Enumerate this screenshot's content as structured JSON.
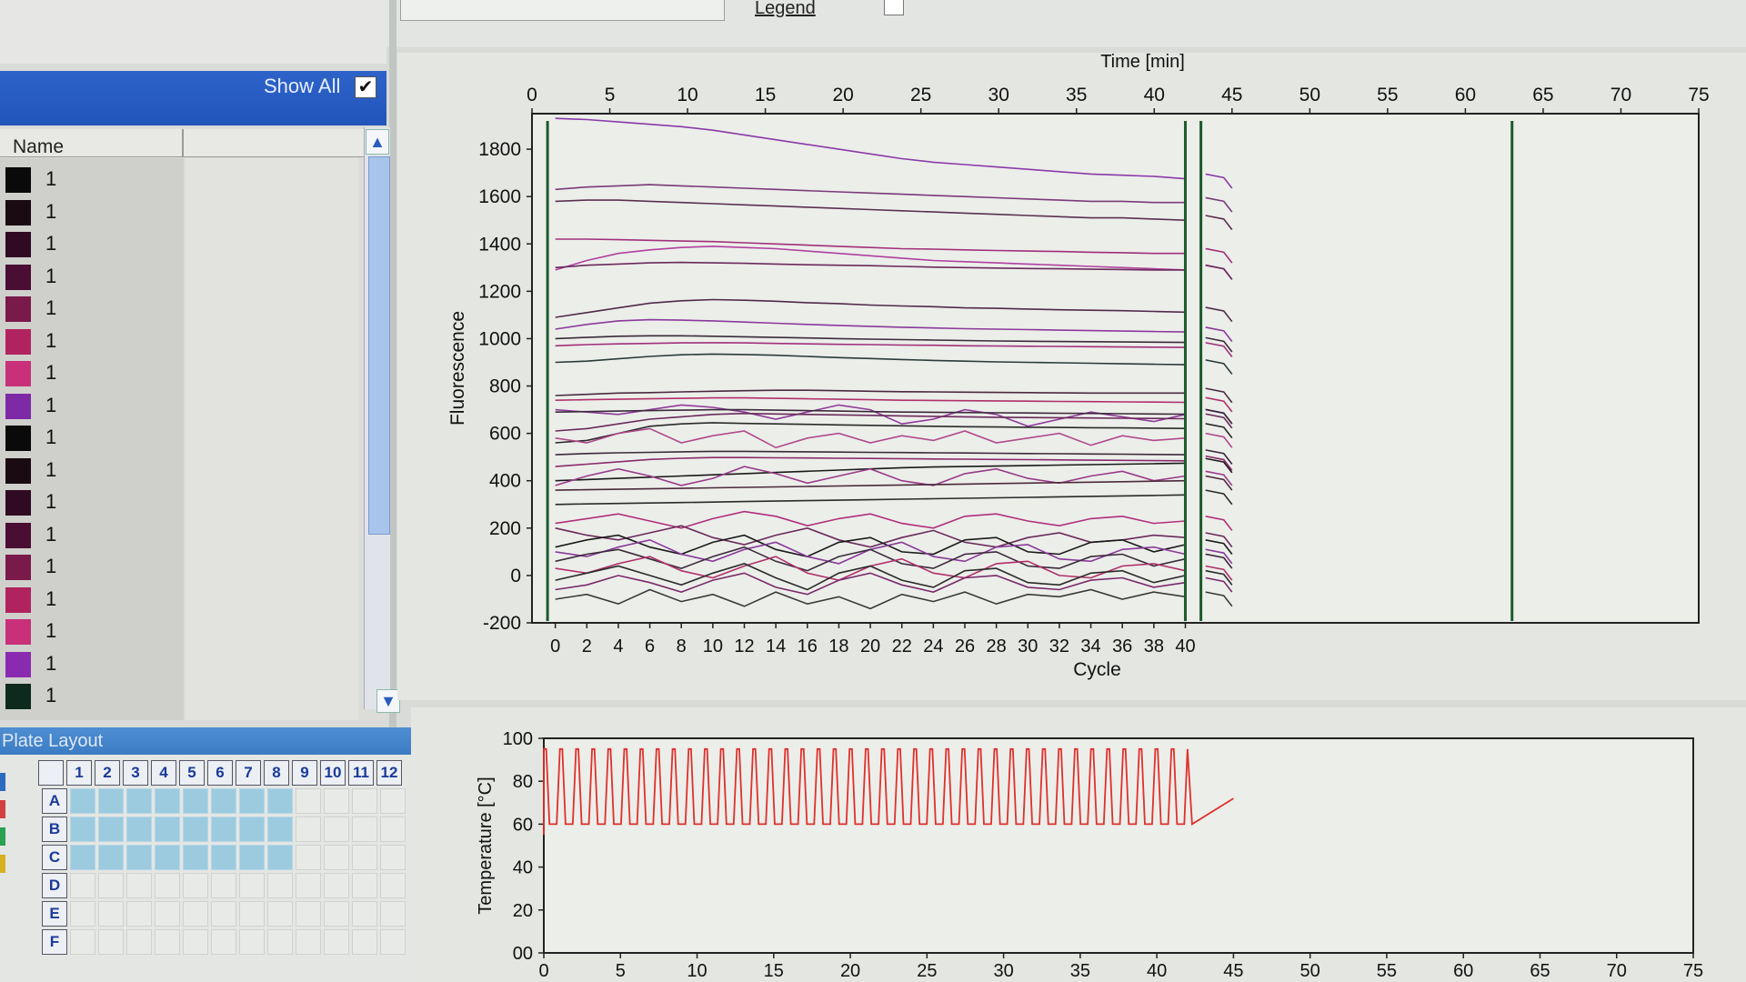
{
  "top_toolbar": {
    "legend_label": "Legend"
  },
  "sample_list": {
    "show_all_label": "Show All",
    "show_all_checked": true,
    "column_name": "Name",
    "rows": [
      {
        "label": "1",
        "color": "#0a0a0a"
      },
      {
        "label": "1",
        "color": "#1a0a12"
      },
      {
        "label": "1",
        "color": "#300a22"
      },
      {
        "label": "1",
        "color": "#4a0d34"
      },
      {
        "label": "1",
        "color": "#7a1a4a"
      },
      {
        "label": "1",
        "color": "#b0235e"
      },
      {
        "label": "1",
        "color": "#c8307a"
      },
      {
        "label": "1",
        "color": "#7e2aa6"
      },
      {
        "label": "1",
        "color": "#0a0a0a"
      },
      {
        "label": "1",
        "color": "#1a0a12"
      },
      {
        "label": "1",
        "color": "#300a22"
      },
      {
        "label": "1",
        "color": "#4a0d34"
      },
      {
        "label": "1",
        "color": "#7a1a4a"
      },
      {
        "label": "1",
        "color": "#b0235e"
      },
      {
        "label": "1",
        "color": "#c8307a"
      },
      {
        "label": "1",
        "color": "#8a2ab0"
      },
      {
        "label": "1",
        "color": "#0e2a1e"
      }
    ]
  },
  "plate_layout": {
    "title": "Plate Layout",
    "columns": [
      "1",
      "2",
      "3",
      "4",
      "5",
      "6",
      "7",
      "8",
      "9",
      "10",
      "11",
      "12"
    ],
    "rows": [
      "A",
      "B",
      "C",
      "D",
      "E",
      "F"
    ],
    "filled_rows": 3,
    "filled_columns": 8,
    "side_colors": [
      "#2a6cc0",
      "#d24040",
      "#2aa050",
      "#d8b020"
    ]
  },
  "chart_data": [
    {
      "type": "line",
      "x_top_label": "Time [min]",
      "x_top_ticks": [
        "0",
        "5",
        "10",
        "15",
        "20",
        "25",
        "30",
        "35",
        "40",
        "45",
        "50",
        "55",
        "60",
        "65",
        "70",
        "75"
      ],
      "xlabel": "Cycle",
      "x_bottom_ticks": [
        "0",
        "2",
        "4",
        "6",
        "8",
        "10",
        "12",
        "14",
        "16",
        "18",
        "20",
        "22",
        "24",
        "26",
        "28",
        "30",
        "32",
        "34",
        "36",
        "38",
        "40"
      ],
      "ylabel": "Fluorescence",
      "y_ticks": [
        "1800",
        "1600",
        "1400",
        "1200",
        "1000",
        "800",
        "600",
        "400",
        "200",
        "0",
        "-200"
      ],
      "ylim": [
        -200,
        1950
      ],
      "time_range": [
        0,
        75
      ],
      "marker_lines_minutes": [
        1,
        42,
        43,
        63
      ],
      "cycles": 40,
      "series": [
        {
          "color": "#8a3aa8",
          "values": [
            1930,
            1925,
            1915,
            1905,
            1895,
            1880,
            1860,
            1840,
            1820,
            1800,
            1780,
            1760,
            1745,
            1735,
            1725,
            1715,
            1705,
            1695,
            1690,
            1685,
            1675
          ]
        },
        {
          "color": "#7a3a7a",
          "values": [
            1630,
            1640,
            1645,
            1650,
            1645,
            1640,
            1635,
            1630,
            1625,
            1620,
            1615,
            1610,
            1605,
            1600,
            1595,
            1590,
            1585,
            1580,
            1580,
            1575,
            1575
          ]
        },
        {
          "color": "#5a3050",
          "values": [
            1580,
            1585,
            1585,
            1580,
            1575,
            1570,
            1565,
            1560,
            1555,
            1550,
            1545,
            1540,
            1535,
            1530,
            1525,
            1520,
            1515,
            1510,
            1510,
            1505,
            1500
          ]
        },
        {
          "color": "#a0307a",
          "values": [
            1420,
            1420,
            1418,
            1415,
            1412,
            1410,
            1405,
            1400,
            1395,
            1390,
            1385,
            1380,
            1378,
            1375,
            1372,
            1370,
            1368,
            1365,
            1363,
            1360,
            1360
          ]
        },
        {
          "color": "#b040a0",
          "values": [
            1290,
            1330,
            1360,
            1375,
            1385,
            1390,
            1385,
            1380,
            1370,
            1360,
            1350,
            1340,
            1330,
            1325,
            1320,
            1315,
            1310,
            1305,
            1300,
            1295,
            1290
          ]
        },
        {
          "color": "#6a2a5a",
          "values": [
            1300,
            1310,
            1315,
            1320,
            1322,
            1320,
            1318,
            1315,
            1312,
            1310,
            1308,
            1305,
            1302,
            1300,
            1298,
            1296,
            1295,
            1293,
            1292,
            1290,
            1290
          ]
        },
        {
          "color": "#502a4a",
          "values": [
            1090,
            1110,
            1130,
            1150,
            1160,
            1165,
            1162,
            1158,
            1152,
            1148,
            1142,
            1138,
            1135,
            1130,
            1128,
            1125,
            1122,
            1120,
            1118,
            1115,
            1112
          ]
        },
        {
          "color": "#8a3a9a",
          "values": [
            1040,
            1060,
            1075,
            1080,
            1078,
            1075,
            1070,
            1065,
            1060,
            1056,
            1052,
            1048,
            1045,
            1042,
            1040,
            1038,
            1036,
            1034,
            1032,
            1030,
            1028
          ]
        },
        {
          "color": "#3a2a3a",
          "values": [
            1000,
            1005,
            1010,
            1012,
            1012,
            1010,
            1008,
            1005,
            1003,
            1000,
            998,
            996,
            994,
            992,
            990,
            989,
            988,
            987,
            986,
            985,
            984
          ]
        },
        {
          "color": "#a0307a",
          "values": [
            970,
            975,
            978,
            980,
            982,
            983,
            982,
            980,
            978,
            976,
            975,
            973,
            972,
            970,
            969,
            968,
            967,
            966,
            965,
            964,
            963
          ]
        },
        {
          "color": "#2a3a3a",
          "values": [
            900,
            905,
            915,
            925,
            932,
            935,
            933,
            930,
            925,
            920,
            916,
            912,
            908,
            905,
            902,
            900,
            898,
            896,
            894,
            892,
            890
          ]
        },
        {
          "color": "#4a2a40",
          "values": [
            760,
            765,
            770,
            772,
            775,
            778,
            780,
            782,
            782,
            780,
            778,
            776,
            775,
            774,
            773,
            772,
            771,
            770,
            770,
            770,
            770
          ]
        },
        {
          "color": "#b0306a",
          "values": [
            740,
            742,
            744,
            746,
            748,
            750,
            750,
            748,
            746,
            744,
            742,
            740,
            739,
            738,
            737,
            736,
            735,
            734,
            733,
            732,
            731
          ]
        },
        {
          "color": "#903a9a",
          "values": [
            700,
            690,
            680,
            700,
            720,
            710,
            690,
            660,
            690,
            720,
            700,
            640,
            660,
            700,
            680,
            630,
            660,
            690,
            670,
            650,
            680
          ]
        },
        {
          "color": "#3a2a3a",
          "values": [
            690,
            692,
            694,
            696,
            698,
            700,
            700,
            698,
            696,
            694,
            692,
            690,
            689,
            688,
            687,
            686,
            685,
            684,
            683,
            682,
            681
          ]
        },
        {
          "color": "#6a2a5a",
          "values": [
            610,
            620,
            640,
            660,
            670,
            680,
            684,
            682,
            680,
            678,
            676,
            674,
            672,
            670,
            668,
            667,
            666,
            665,
            664,
            663,
            662
          ]
        },
        {
          "color": "#2a2a2a",
          "values": [
            560,
            570,
            600,
            630,
            640,
            645,
            642,
            640,
            638,
            636,
            634,
            632,
            630,
            628,
            627,
            626,
            625,
            624,
            623,
            622,
            621
          ]
        },
        {
          "color": "#b04a8a",
          "values": [
            580,
            560,
            600,
            620,
            560,
            590,
            610,
            540,
            580,
            600,
            560,
            590,
            570,
            610,
            560,
            580,
            600,
            550,
            590,
            570,
            580
          ]
        },
        {
          "color": "#3a2a3a",
          "values": [
            510,
            515,
            518,
            520,
            522,
            524,
            524,
            523,
            522,
            521,
            520,
            519,
            518,
            517,
            516,
            515,
            514,
            513,
            512,
            511,
            510
          ]
        },
        {
          "color": "#8a2a6a",
          "values": [
            460,
            470,
            480,
            490,
            495,
            498,
            498,
            497,
            496,
            495,
            494,
            493,
            492,
            491,
            490,
            489,
            488,
            487,
            486,
            485,
            484
          ]
        },
        {
          "color": "#1a1a1a",
          "values": [
            400,
            405,
            410,
            415,
            420,
            425,
            430,
            435,
            440,
            445,
            450,
            455,
            458,
            460,
            462,
            464,
            466,
            468,
            470,
            472,
            474
          ]
        },
        {
          "color": "#9a3a8a",
          "values": [
            380,
            420,
            450,
            420,
            380,
            410,
            460,
            430,
            390,
            420,
            450,
            400,
            380,
            430,
            450,
            410,
            390,
            420,
            440,
            400,
            420
          ]
        },
        {
          "color": "#4a2a3a",
          "values": [
            360,
            362,
            364,
            366,
            368,
            370,
            372,
            374,
            376,
            378,
            380,
            382,
            384,
            386,
            388,
            390,
            392,
            394,
            396,
            398,
            400
          ]
        },
        {
          "color": "#2a2a2a",
          "values": [
            300,
            302,
            304,
            306,
            308,
            310,
            312,
            314,
            316,
            318,
            320,
            322,
            324,
            326,
            328,
            330,
            332,
            334,
            336,
            338,
            340
          ]
        },
        {
          "color": "#b0307a",
          "values": [
            220,
            240,
            260,
            230,
            200,
            240,
            270,
            250,
            210,
            240,
            260,
            220,
            200,
            250,
            260,
            230,
            210,
            240,
            250,
            220,
            230
          ]
        },
        {
          "color": "#6a2a5a",
          "values": [
            200,
            170,
            150,
            180,
            210,
            160,
            130,
            170,
            200,
            150,
            120,
            160,
            190,
            140,
            120,
            160,
            180,
            140,
            150,
            170,
            160
          ]
        },
        {
          "color": "#1a1a1a",
          "values": [
            120,
            150,
            170,
            120,
            90,
            140,
            170,
            110,
            80,
            140,
            160,
            100,
            90,
            150,
            160,
            100,
            90,
            140,
            150,
            100,
            130
          ]
        },
        {
          "color": "#8a3a9a",
          "values": [
            100,
            80,
            120,
            150,
            90,
            60,
            110,
            140,
            80,
            50,
            110,
            140,
            80,
            60,
            120,
            130,
            70,
            60,
            110,
            120,
            90
          ]
        },
        {
          "color": "#3a2a3a",
          "values": [
            60,
            90,
            110,
            70,
            30,
            80,
            120,
            60,
            20,
            80,
            110,
            50,
            30,
            90,
            100,
            40,
            30,
            80,
            90,
            40,
            70
          ]
        },
        {
          "color": "#b0306a",
          "values": [
            30,
            10,
            50,
            80,
            20,
            -10,
            40,
            80,
            10,
            -20,
            40,
            70,
            10,
            -10,
            50,
            60,
            0,
            -10,
            40,
            50,
            20
          ]
        },
        {
          "color": "#2a2a2a",
          "values": [
            -20,
            10,
            40,
            0,
            -40,
            10,
            50,
            -10,
            -60,
            10,
            40,
            -20,
            -50,
            20,
            30,
            -30,
            -40,
            10,
            20,
            -30,
            0
          ]
        },
        {
          "color": "#7a2a6a",
          "values": [
            -60,
            -40,
            0,
            -30,
            -70,
            -20,
            10,
            -50,
            -80,
            -20,
            10,
            -40,
            -70,
            -10,
            0,
            -50,
            -60,
            -20,
            -10,
            -50,
            -30
          ]
        },
        {
          "color": "#3a3a3a",
          "values": [
            -100,
            -80,
            -120,
            -60,
            -110,
            -80,
            -130,
            -70,
            -120,
            -90,
            -140,
            -80,
            -110,
            -70,
            -120,
            -80,
            -90,
            -60,
            -100,
            -70,
            -90
          ]
        }
      ]
    },
    {
      "type": "line",
      "ylabel": "Temperature [°C]",
      "y_ticks": [
        "100",
        "80",
        "60",
        "40",
        "20",
        "00"
      ],
      "ylim": [
        0,
        100
      ],
      "x_ticks": [
        "0",
        "5",
        "10",
        "15",
        "20",
        "25",
        "30",
        "35",
        "40",
        "45",
        "50",
        "55",
        "60",
        "65",
        "70",
        "75"
      ],
      "xlim": [
        0,
        75
      ],
      "series": [
        {
          "name": "temperature",
          "color": "#e0302a",
          "cycles": 40,
          "high": 95,
          "low": 60,
          "start_min": 0,
          "end_min": 42,
          "tail_end_min": 45,
          "tail_value": 72
        }
      ]
    }
  ]
}
